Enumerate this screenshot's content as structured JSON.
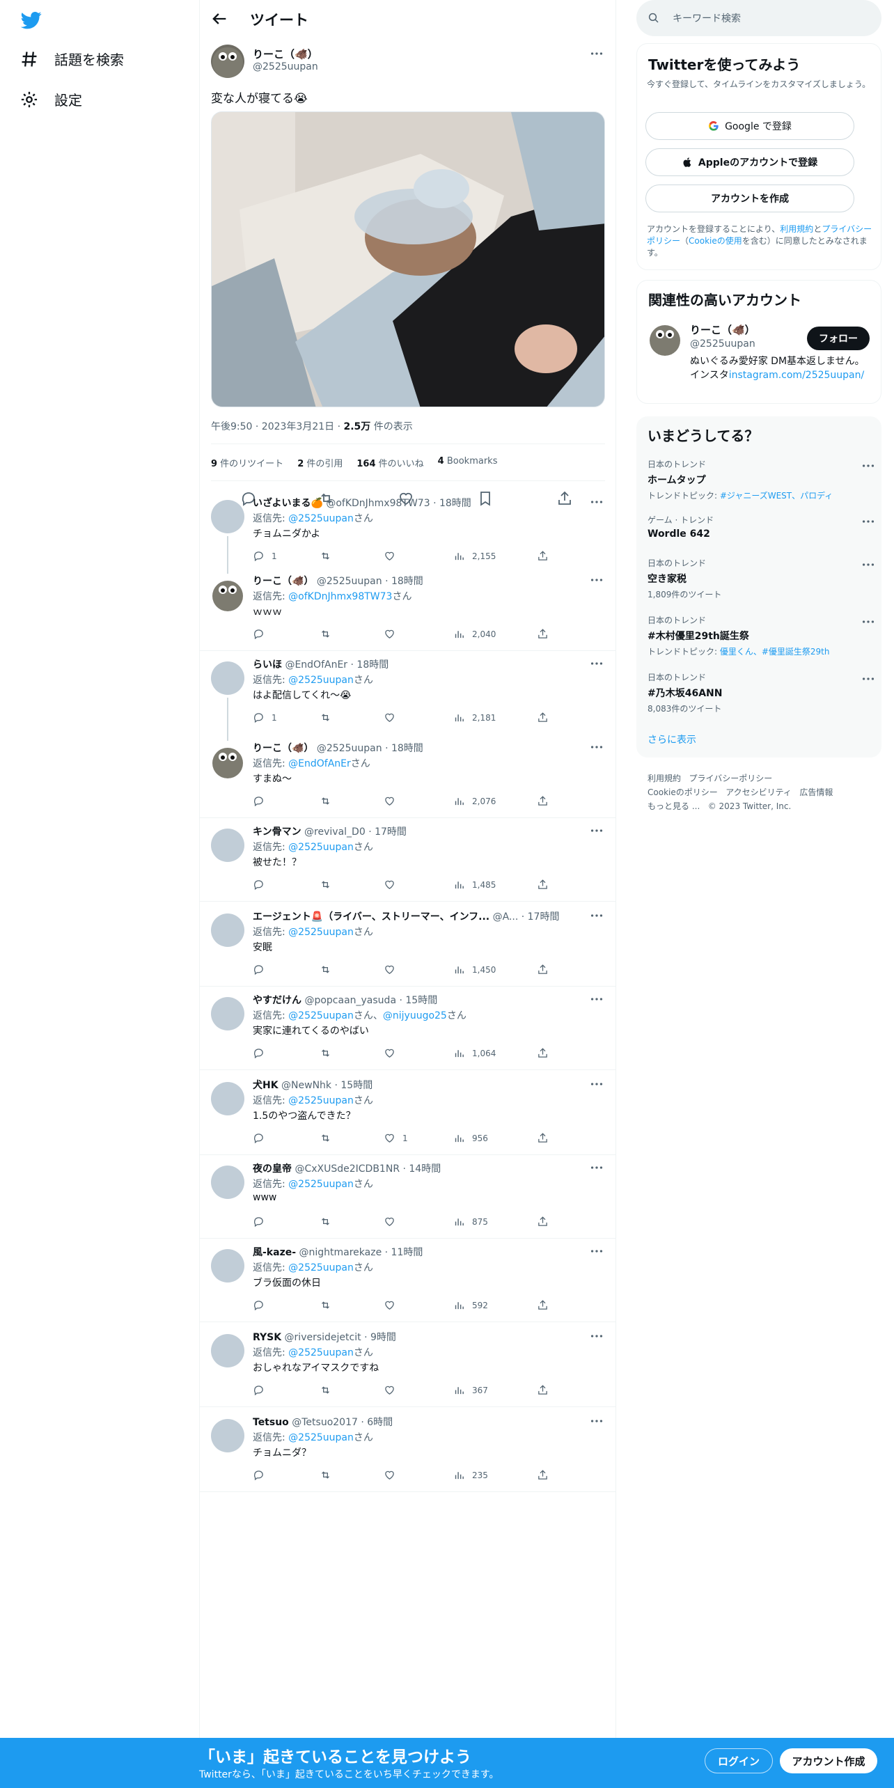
{
  "nav": {
    "explore_label": "話題を検索",
    "settings_label": "設定"
  },
  "header": {
    "title": "ツイート"
  },
  "main_tweet": {
    "name": "りーこ（🐗）",
    "handle": "@2525uupan",
    "text": "変な人が寝てる😭",
    "time": "午後9:50 · 2023年3月21日 · ",
    "views_num": "2.5万",
    "views_label": " 件の表示",
    "stats": [
      {
        "num": "9",
        "label": " 件のリツイート"
      },
      {
        "num": "2",
        "label": " 件の引用"
      },
      {
        "num": "164",
        "label": " 件のいいね"
      },
      {
        "num": "4",
        "label": " Bookmarks"
      }
    ]
  },
  "replies": [
    {
      "name": "いざよいまる🍊",
      "handle": "@ofKDnJhmx98TW73",
      "time": "· 18時間",
      "replyto_prefix": "返信先: ",
      "replyto": "@2525uupan",
      "replyto_suffix": "さん",
      "text": "チョムニダかよ",
      "replies": "1",
      "retweets": "",
      "likes": "",
      "views": "2,155"
    },
    {
      "name": "りーこ（🐗）",
      "handle": "@2525uupan",
      "time": "· 18時間",
      "replyto_prefix": "返信先: ",
      "replyto": "@ofKDnJhmx98TW73",
      "replyto_suffix": "さん",
      "text": "ｗｗｗ",
      "replies": "",
      "retweets": "",
      "likes": "",
      "views": "2,040"
    },
    {
      "name": "らいほ",
      "handle": "@EndOfAnEr",
      "time": "· 18時間",
      "replyto_prefix": "返信先: ",
      "replyto": "@2525uupan",
      "replyto_suffix": "さん",
      "text": "はよ配信してくれ〜😭",
      "replies": "1",
      "retweets": "",
      "likes": "",
      "views": "2,181"
    },
    {
      "name": "りーこ（🐗）",
      "handle": "@2525uupan",
      "time": "· 18時間",
      "replyto_prefix": "返信先: ",
      "replyto": "@EndOfAnEr",
      "replyto_suffix": "さん",
      "text": "すまぬ〜",
      "replies": "",
      "retweets": "",
      "likes": "",
      "views": "2,076"
    },
    {
      "name": "キン骨マン",
      "handle": "@revival_D0",
      "time": "· 17時間",
      "replyto_prefix": "返信先: ",
      "replyto": "@2525uupan",
      "replyto_suffix": "さん",
      "text": "被せた！？",
      "replies": "",
      "retweets": "",
      "likes": "",
      "views": "1,485"
    },
    {
      "name": "エージェント🚨（ライバー、ストリーマー、インフ...",
      "handle": "@A...",
      "time": "· 17時間",
      "replyto_prefix": "返信先: ",
      "replyto": "@2525uupan",
      "replyto_suffix": "さん",
      "text": "安眠",
      "replies": "",
      "retweets": "",
      "likes": "",
      "views": "1,450"
    },
    {
      "name": "やすだけん",
      "handle": "@popcaan_yasuda",
      "time": "· 15時間",
      "replyto_prefix": "返信先: ",
      "replyto": "@2525uupan",
      "replyto_suffix": "さん、",
      "replyto2": "@nijyuugo25",
      "replyto2_suffix": "さん",
      "text": "実家に連れてくるのやばい",
      "replies": "",
      "retweets": "",
      "likes": "",
      "views": "1,064"
    },
    {
      "name": "犬HK",
      "handle": "@NewNhk",
      "time": "· 15時間",
      "replyto_prefix": "返信先: ",
      "replyto": "@2525uupan",
      "replyto_suffix": "さん",
      "text": "1.5のやつ盗んできた？",
      "replies": "",
      "retweets": "",
      "likes": "1",
      "views": "956"
    },
    {
      "name": "夜の皇帝",
      "handle": "@CxXUSde2ICDB1NR",
      "time": "· 14時間",
      "replyto_prefix": "返信先: ",
      "replyto": "@2525uupan",
      "replyto_suffix": "さん",
      "text": "www",
      "replies": "",
      "retweets": "",
      "likes": "",
      "views": "875"
    },
    {
      "name": "風-kaze-",
      "handle": "@nightmarekaze",
      "time": "· 11時間",
      "replyto_prefix": "返信先: ",
      "replyto": "@2525uupan",
      "replyto_suffix": "さん",
      "text": "ブラ仮面の休日",
      "replies": "",
      "retweets": "",
      "likes": "",
      "views": "592"
    },
    {
      "name": "RYSK",
      "handle": "@riversidejetcit",
      "time": "· 9時間",
      "replyto_prefix": "返信先: ",
      "replyto": "@2525uupan",
      "replyto_suffix": "さん",
      "text": "おしゃれなアイマスクですね",
      "replies": "",
      "retweets": "",
      "likes": "",
      "views": "367"
    },
    {
      "name": "Tetsuo",
      "handle": "@Tetsuo2017",
      "time": "· 6時間",
      "replyto_prefix": "返信先: ",
      "replyto": "@2525uupan",
      "replyto_suffix": "さん",
      "text": "チョムニダ？",
      "replies": "",
      "retweets": "",
      "likes": "",
      "views": "235"
    }
  ],
  "right": {
    "search_placeholder": "キーワード検索",
    "signup_card": {
      "title": "Twitterを使ってみよう",
      "desc": "今すぐ登録して、タイムラインをカスタマイズしましょう。",
      "google_label": "Google で登録",
      "apple_label": "Appleのアカウントで登録",
      "create_label": "アカウントを作成",
      "terms_prefix": "アカウントを登録することにより、",
      "terms_link": "利用規約",
      "terms_and": "と",
      "privacy_link": "プライバシーポリシー",
      "cookie_open": "（",
      "cookie_link": "Cookieの使用",
      "terms_suffix": "を含む）に同意したとみなされます。"
    },
    "related": {
      "title": "関連性の高いアカウント",
      "name": "りーこ（🐗）",
      "handle": "@2525uupan",
      "follow_label": "フォロー",
      "bio": "ぬいぐるみ愛好家 DM基本返しません。インスタ",
      "bio_link": "instagram.com/2525uupan/"
    },
    "trends": {
      "title": "いまどうしてる？",
      "items": [
        {
          "cat": "日本のトレンド",
          "title": "ホームタップ",
          "sub_prefix": "トレンドトピック: ",
          "sub_link": "#ジャニーズWEST、パロディ"
        },
        {
          "cat": "ゲーム · トレンド",
          "title": "Wordle 642",
          "sub_prefix": "",
          "sub_link": ""
        },
        {
          "cat": "日本のトレンド",
          "title": "空き家税",
          "sub_prefix": "1,809件のツイート",
          "sub_link": ""
        },
        {
          "cat": "日本のトレンド",
          "title": "#木村優里29th誕生祭",
          "sub_prefix": "トレンドトピック: ",
          "sub_link": "優里くん、#優里誕生祭29th"
        },
        {
          "cat": "日本のトレンド",
          "title": "#乃木坂46ANN",
          "sub_prefix": "8,083件のツイート",
          "sub_link": ""
        }
      ],
      "show_more": "さらに表示"
    },
    "footer": {
      "l1": "利用規約",
      "l2": "プライバシーポリシー",
      "l3": "Cookieのポリシー",
      "l4": "アクセシビリティ",
      "l5": "広告情報",
      "l6": "もっと見る ...",
      "copyright": "© 2023 Twitter, Inc."
    }
  },
  "bottom_bar": {
    "title": "「いま」起きていることを見つけよう",
    "subtitle": "Twitterなら、「いま」起きていることをいち早くチェックできます。",
    "login": "ログイン",
    "signup": "アカウント作成"
  },
  "colors": {
    "accent": "#1d9bf0",
    "text": "#0f1419",
    "muted": "#536471"
  }
}
